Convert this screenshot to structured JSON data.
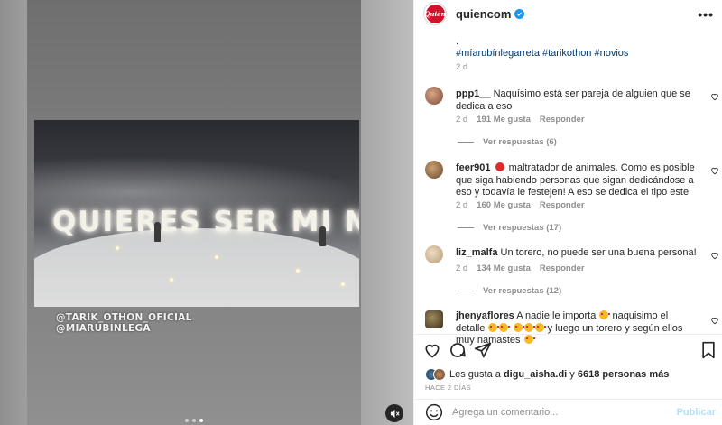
{
  "post": {
    "username": "quiencom",
    "logo_text": "Quién",
    "credits": [
      "@TARIK_OTHON_OFICIAL",
      "@MIARUBINLEGA"
    ],
    "sign_text": "QUIERES SER MI NOV A"
  },
  "caption": {
    "dot": ".",
    "hashtags": "#míarubínlegarreta #tarikothon #novios",
    "time": "2 d"
  },
  "comments": [
    {
      "user": "ppp1__",
      "text": "Naquísimo está ser pareja de alguien que se dedica a eso",
      "time": "2 d",
      "likes": "191 Me gusta",
      "reply": "Responder",
      "view_replies": "Ver respuestas (6)"
    },
    {
      "user": "feer901",
      "text": "maltratador de animales. Como es posible que siga habiendo personas que sigan dedicándose a eso y todavía le festejen! A eso se dedica el tipo este",
      "time": "2 d",
      "likes": "160 Me gusta",
      "reply": "Responder",
      "view_replies": "Ver respuestas (17)"
    },
    {
      "user": "liz_malfa",
      "text": "Un torero, no puede ser una buena persona!",
      "time": "2 d",
      "likes": "134 Me gusta",
      "reply": "Responder",
      "view_replies": "Ver respuestas (12)"
    },
    {
      "user": "jhenyaflores",
      "text_a": "A nadie le importa",
      "text_b": "naquisimo el detalle",
      "text_c": "y luego un torero y según ellos muy namastes"
    }
  ],
  "likes_line": {
    "prefix": "Les gusta a",
    "user": "digu_aisha.di",
    "connector": "y",
    "others": "6618 personas más"
  },
  "posted_ago": "HACE 2 DÍAS",
  "comment_box": {
    "placeholder": "Agrega un comentario...",
    "post_label": "Publicar"
  },
  "colors": {
    "link": "#00376b",
    "muted": "#8e8e8e",
    "brand": "#d4102a",
    "verified": "#1e96f0"
  },
  "icons": [
    "heart-icon",
    "comment-icon",
    "share-icon",
    "bookmark-icon",
    "more-icon",
    "emoji-icon",
    "mute-icon",
    "verified-icon"
  ]
}
